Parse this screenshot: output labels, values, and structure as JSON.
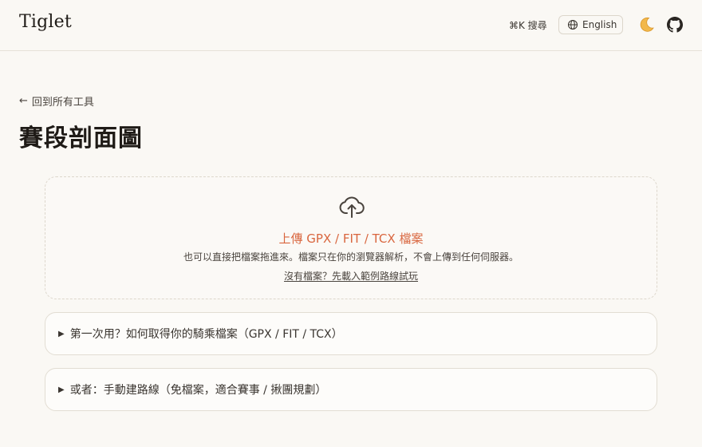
{
  "header": {
    "logo": "Tiglet",
    "search_label": "⌘K 搜尋",
    "language_label": "English",
    "icons": {
      "language": "globe-icon",
      "theme": "moon-icon",
      "repo": "github-icon"
    }
  },
  "back_link": {
    "arrow": "←",
    "label": "回到所有工具"
  },
  "page": {
    "title": "賽段剖面圖"
  },
  "upload": {
    "icon": "cloud-upload-icon",
    "title": "上傳 GPX / FIT / TCX 檔案",
    "description": "也可以直接把檔案拖進來。檔案只在你的瀏覽器解析，不會上傳到任何伺服器。",
    "sample_link": "沒有檔案？先載入範例路線試玩"
  },
  "accordions": [
    {
      "caret": "▶",
      "label": "第一次用？如何取得你的騎乘檔案（GPX / FIT / TCX）"
    },
    {
      "caret": "▶",
      "label": "或者：手動建路線（免檔案，適合賽事 / 揪團規劃）"
    }
  ],
  "colors": {
    "accent": "#d9663f",
    "background": "#faf8f4",
    "border": "#e2ddd3"
  }
}
